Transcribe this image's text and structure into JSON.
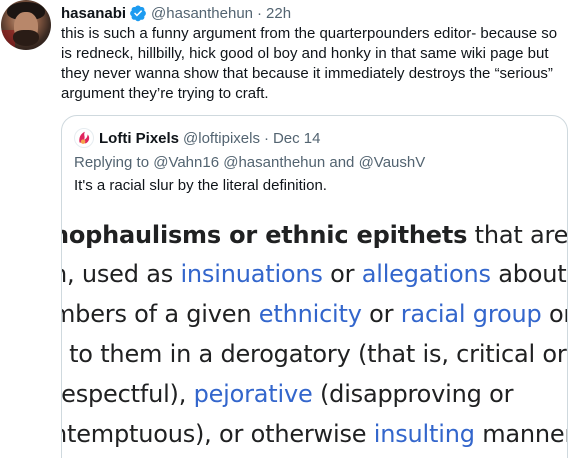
{
  "tweet": {
    "author_name": "hasanabi",
    "author_handle": "@hasanthehun",
    "separator": "·",
    "time": "22h",
    "text": "this is such a funny argument from the quarterpounders editor- because so is redneck, hillbilly, hick good ol boy and honky in that same wiki page but they never wanna show that because it immediately destroys the “serious” argument they’re trying to craft."
  },
  "quote": {
    "author_name": "Lofti Pixels",
    "author_handle": "@loftipixels",
    "separator": "·",
    "time": "Dec 14",
    "replying_prefix": "Replying to",
    "replying_mentions": "@Vahn16 @hasanthehun",
    "replying_and": "and",
    "replying_last": "@VaushV",
    "text": "It's a racial slur by the literal definition.",
    "image_lines": [
      [
        {
          "t": "nophaulisms or ethnic epithets",
          "s": "bold"
        },
        {
          "t": " that are, or have",
          "s": "text"
        }
      ],
      [
        {
          "t": "n, used as ",
          "s": "text"
        },
        {
          "t": "insinuations",
          "s": "link"
        },
        {
          "t": " or ",
          "s": "text"
        },
        {
          "t": "allegations",
          "s": "link"
        },
        {
          "t": " about",
          "s": "text"
        }
      ],
      [
        {
          "t": "mbers of a given ",
          "s": "text"
        },
        {
          "t": "ethnicity",
          "s": "link"
        },
        {
          "t": " or ",
          "s": "text"
        },
        {
          "t": "racial group",
          "s": "link"
        },
        {
          "t": " or to",
          "s": "text"
        }
      ],
      [
        {
          "t": "r to them in a derogatory (that is, critical or",
          "s": "text"
        }
      ],
      [
        {
          "t": "respectful), ",
          "s": "text"
        },
        {
          "t": "pejorative",
          "s": "link"
        },
        {
          "t": " (disapproving or",
          "s": "text"
        }
      ],
      [
        {
          "t": "ntemptuous), or otherwise ",
          "s": "text"
        },
        {
          "t": "insulting",
          "s": "link"
        },
        {
          "t": " manner.",
          "s": "text"
        }
      ]
    ]
  },
  "colors": {
    "text": "#0f1419",
    "secondary": "#536471",
    "verified": "#1d9bf0",
    "wiki_link": "#3366cc",
    "border": "#cfd9de"
  }
}
